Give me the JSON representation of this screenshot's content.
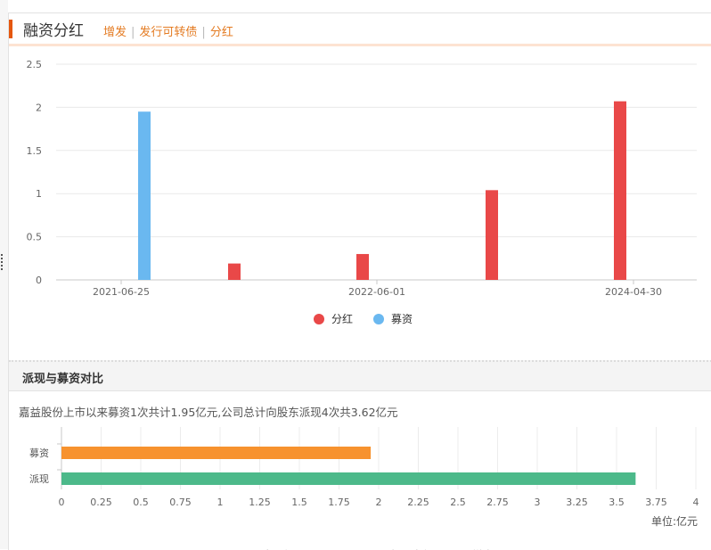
{
  "header": {
    "title": "融资分红",
    "links": [
      "增发",
      "发行可转债",
      "分红"
    ]
  },
  "colors": {
    "dividend": "#e94848",
    "fundraise": "#6ab8f0",
    "cash_dividend": "#4cb98a",
    "rights_issue": "#e94848",
    "new_issue": "#f7922e",
    "additional_issue": "#6ab8f0"
  },
  "section2": {
    "title": "派现与募资对比",
    "summary": "嘉益股份上市以来募资1次共计1.95亿元,公司总计向股东派现4次共3.62亿元",
    "unit": "单位:亿元"
  },
  "chart_data": [
    {
      "type": "bar",
      "x_tick_labels": [
        "2021-06-25",
        "2022-06-01",
        "2024-04-30"
      ],
      "ylim": [
        0,
        2.5
      ],
      "y_ticks": [
        "0",
        "0.5",
        "1",
        "1.5",
        "2",
        "2.5"
      ],
      "grid": true,
      "legend_position": "bottom",
      "legend": [
        {
          "name": "分红",
          "color": "#e94848"
        },
        {
          "name": "募资",
          "color": "#6ab8f0"
        }
      ],
      "series": [
        {
          "name": "募资",
          "x": [
            "2021-06-25"
          ],
          "values": [
            1.95
          ]
        },
        {
          "name": "分红",
          "values": [
            0.19,
            0.3,
            1.04,
            2.07
          ]
        }
      ]
    },
    {
      "type": "bar",
      "orientation": "horizontal",
      "categories": [
        "募资",
        "派现"
      ],
      "values": [
        1.95,
        3.62
      ],
      "bar_colors": [
        "#f7922e",
        "#4cb98a"
      ],
      "xlim": [
        0,
        4
      ],
      "x_ticks": [
        "0",
        "0.25",
        "0.5",
        "0.75",
        "1",
        "1.25",
        "1.5",
        "1.75",
        "2",
        "2.25",
        "2.5",
        "2.75",
        "3",
        "3.25",
        "3.5",
        "3.75",
        "4"
      ],
      "grid": true,
      "legend_position": "bottom",
      "legend": [
        {
          "name": "现金分红",
          "color": "#4cb98a"
        },
        {
          "name": "配股",
          "color": "#e94848"
        },
        {
          "name": "新股发行",
          "color": "#f7922e"
        },
        {
          "name": "增发",
          "color": "#6ab8f0"
        }
      ]
    }
  ]
}
